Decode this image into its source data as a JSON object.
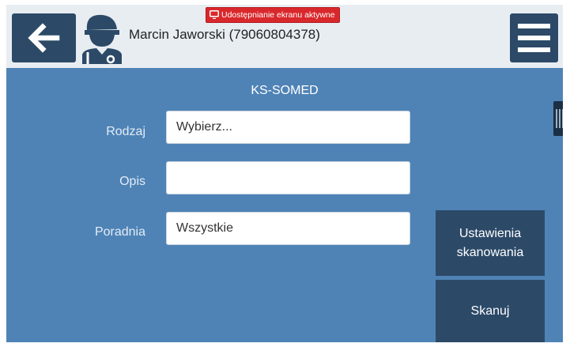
{
  "screen_share_badge": {
    "text": "Udostępnianie ekranu aktywne",
    "icon": "screen-cast-icon",
    "color": "#d9282c"
  },
  "header": {
    "back_icon": "arrow-left-icon",
    "user_icon": "doctor-icon",
    "user_name": "Marcin Jaworski (79060804378)",
    "menu_icon": "hamburger-menu-icon"
  },
  "form": {
    "title": "KS-SOMED",
    "rodzaj_label": "Rodzaj",
    "rodzaj_value": "Wybierz...",
    "opis_label": "Opis",
    "opis_value": "",
    "poradnia_label": "Poradnia",
    "poradnia_value": "Wszystkie"
  },
  "buttons": {
    "scan_settings": "Ustawienia skanowania",
    "scan": "Skanuj"
  },
  "colors": {
    "header_bg": "#e8edf2",
    "button_bg": "#2c4a68",
    "main_bg": "#4f83b6"
  }
}
